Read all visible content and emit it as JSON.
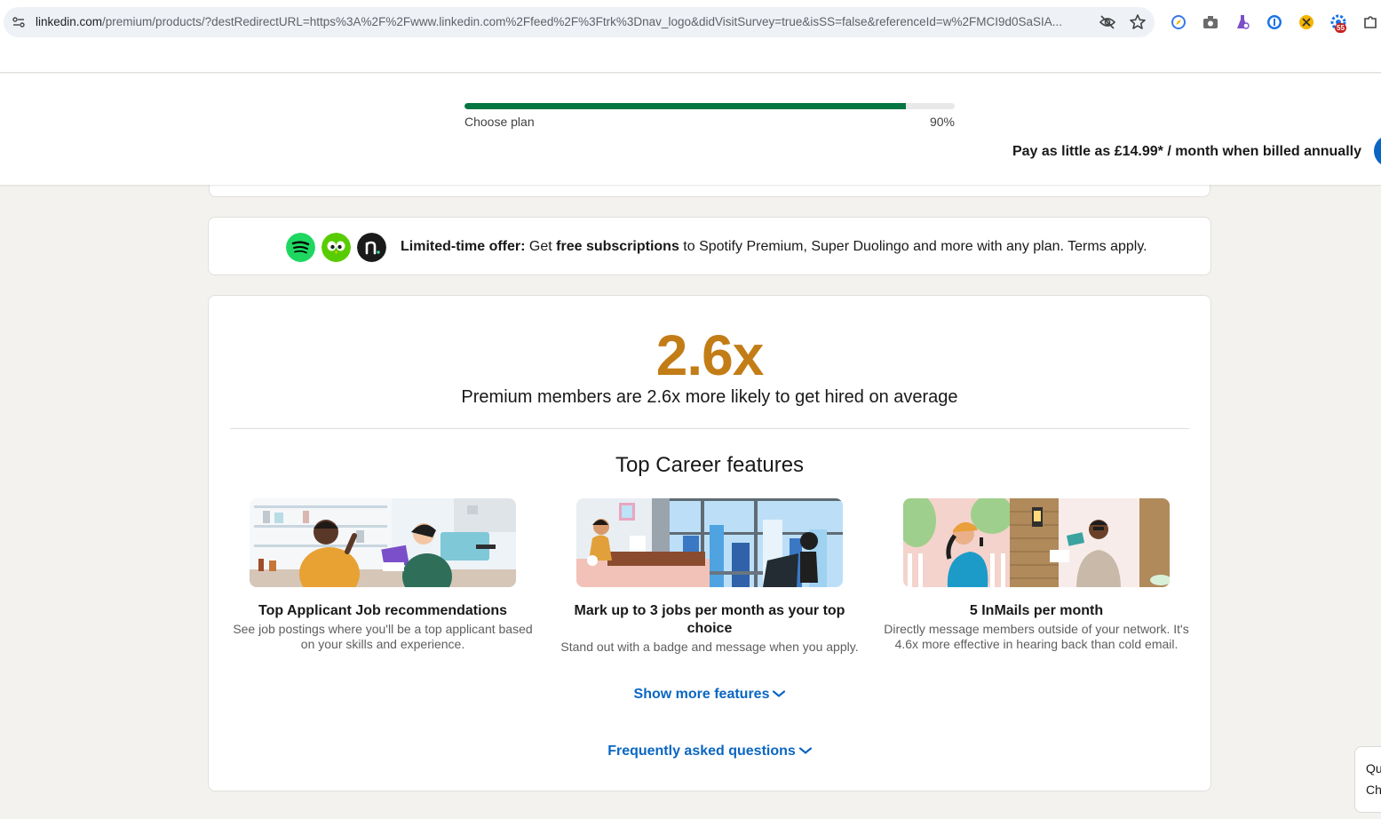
{
  "browser": {
    "url_host": "linkedin.com",
    "url_path": "/premium/products/?destRedirectURL=https%3A%2F%2Fwww.linkedin.com%2Ffeed%2F%3Ftrk%3Dnav_logo&didVisitSurvey=true&isSS=false&referenceId=w%2FMCI9d0SaSIA...",
    "extension_badge": "55",
    "icons": [
      "site-info-icon",
      "eye-off-icon",
      "star-icon",
      "extension-icons",
      "puzzle-icon"
    ]
  },
  "progress": {
    "label": "Choose plan",
    "percent_text": "90%",
    "value": 0.9
  },
  "pricing": {
    "note": "Pay as little as £14.99* / month when billed annually"
  },
  "offer": {
    "lead": "Limited-time offer:",
    "mid1": " Get ",
    "bold2": "free subscriptions",
    "rest": " to Spotify Premium, Super Duolingo and more with any plan. Terms apply."
  },
  "stat": {
    "value": "2.6x",
    "caption": "Premium members are 2.6x more likely to get hired on average"
  },
  "features_title": "Top Career features",
  "features": [
    {
      "title": "Top Applicant Job recommendations",
      "desc": "See job postings where you'll be a top applicant based on your skills and experience."
    },
    {
      "title": "Mark up to 3 jobs per month as your top choice",
      "desc": "Stand out with a badge and message when you apply."
    },
    {
      "title": "5 InMails per month",
      "desc": "Directly message members outside of your network. It's 4.6x more effective in hearing back than cold email."
    }
  ],
  "links": {
    "show_more": "Show more features",
    "faq": "Frequently asked questions"
  },
  "chat": {
    "line1": "Qu",
    "line2": "Ch"
  },
  "colors": {
    "brand_blue": "#0a66c2",
    "progress_green": "#057642",
    "stat_gold": "#c37d16"
  }
}
